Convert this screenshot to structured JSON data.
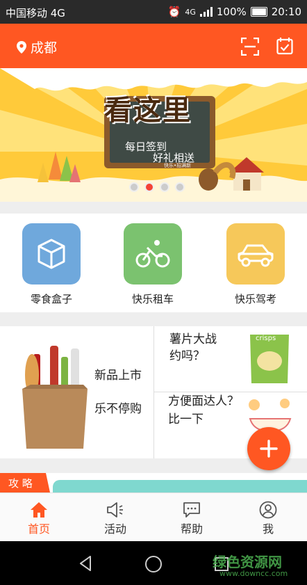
{
  "status": {
    "carrier": "中国移动 4G",
    "network": "4G",
    "battery": "100%",
    "time": "20:10"
  },
  "header": {
    "city": "成都"
  },
  "banner": {
    "headline": "看这里",
    "sub1": "每日签到",
    "sub2": "好礼相送",
    "small": "快乐•招满新",
    "slide_count": 4,
    "active_slide": 2
  },
  "categories": [
    {
      "label": "零食盒子",
      "icon": "box-icon",
      "color": "#6fa8dc"
    },
    {
      "label": "快乐租车",
      "icon": "bicycle-icon",
      "color": "#7bc26f"
    },
    {
      "label": "快乐驾考",
      "icon": "car-icon",
      "color": "#f6c85a"
    }
  ],
  "promo": {
    "left_line1": "新品上市",
    "left_line2": "乐不停购",
    "top_right_line1": "薯片大战",
    "top_right_line2": "约吗？",
    "bottom_right_line1": "方便面达人？",
    "bottom_right_line2": "比一下",
    "chip_bag_text": "crisps"
  },
  "strip": {
    "label": "攻 略"
  },
  "tabs": [
    {
      "label": "首页",
      "icon": "home-icon",
      "active": true
    },
    {
      "label": "活动",
      "icon": "megaphone-icon",
      "active": false
    },
    {
      "label": "帮助",
      "icon": "chat-icon",
      "active": false
    },
    {
      "label": "我",
      "icon": "user-icon",
      "active": false
    }
  ],
  "watermark": {
    "line1": "绿色资源网",
    "line2": "www.downcc.com"
  },
  "colors": {
    "accent": "#ff5722",
    "banner": "#ffd54a"
  }
}
